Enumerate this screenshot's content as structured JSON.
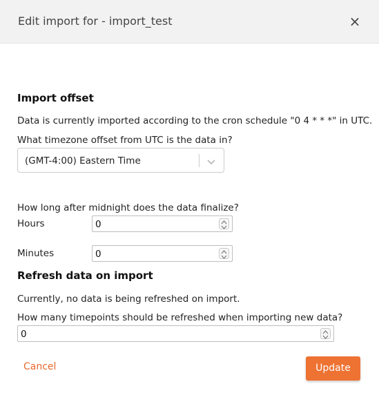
{
  "header": {
    "title": "Edit import for - import_test",
    "close_glyph": "×"
  },
  "import_offset": {
    "title": "Import offset",
    "cron_text": "Data is currently imported according to the cron schedule \"0 4 * * *\" in UTC.",
    "timezone_question": "What timezone offset from UTC is the data in?",
    "timezone_selected": "(GMT-4:00) Eastern Time"
  },
  "finalize": {
    "question": "How long after midnight does the data finalize?",
    "hours_label": "Hours",
    "hours_value": "0",
    "minutes_label": "Minutes",
    "minutes_value": "0"
  },
  "refresh": {
    "title": "Refresh data on import",
    "status_text": "Currently, no data is being refreshed on import.",
    "timepoints_question": "How many timepoints should be refreshed when importing new data?",
    "timepoints_value": "0"
  },
  "footer": {
    "cancel_label": "Cancel",
    "update_label": "Update"
  },
  "colors": {
    "accent": "#ee7232",
    "header_bg": "#f2f2f2"
  }
}
